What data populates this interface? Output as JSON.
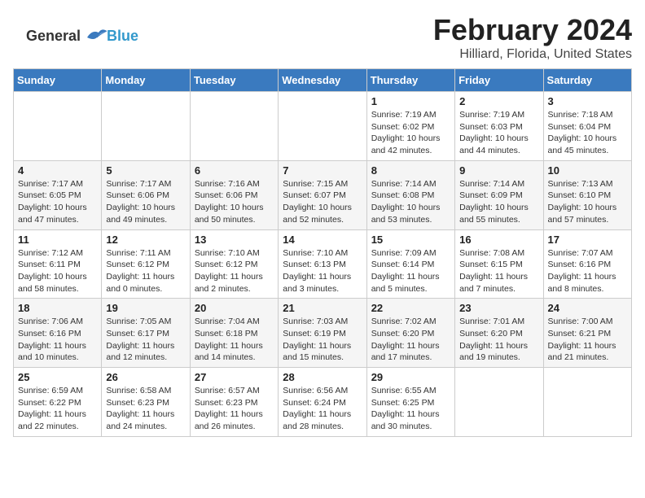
{
  "app": {
    "logo_general": "General",
    "logo_blue": "Blue"
  },
  "header": {
    "month_year": "February 2024",
    "location": "Hilliard, Florida, United States"
  },
  "weekdays": [
    "Sunday",
    "Monday",
    "Tuesday",
    "Wednesday",
    "Thursday",
    "Friday",
    "Saturday"
  ],
  "weeks": [
    [
      {
        "day": "",
        "info": ""
      },
      {
        "day": "",
        "info": ""
      },
      {
        "day": "",
        "info": ""
      },
      {
        "day": "",
        "info": ""
      },
      {
        "day": "1",
        "info": "Sunrise: 7:19 AM\nSunset: 6:02 PM\nDaylight: 10 hours\nand 42 minutes."
      },
      {
        "day": "2",
        "info": "Sunrise: 7:19 AM\nSunset: 6:03 PM\nDaylight: 10 hours\nand 44 minutes."
      },
      {
        "day": "3",
        "info": "Sunrise: 7:18 AM\nSunset: 6:04 PM\nDaylight: 10 hours\nand 45 minutes."
      }
    ],
    [
      {
        "day": "4",
        "info": "Sunrise: 7:17 AM\nSunset: 6:05 PM\nDaylight: 10 hours\nand 47 minutes."
      },
      {
        "day": "5",
        "info": "Sunrise: 7:17 AM\nSunset: 6:06 PM\nDaylight: 10 hours\nand 49 minutes."
      },
      {
        "day": "6",
        "info": "Sunrise: 7:16 AM\nSunset: 6:06 PM\nDaylight: 10 hours\nand 50 minutes."
      },
      {
        "day": "7",
        "info": "Sunrise: 7:15 AM\nSunset: 6:07 PM\nDaylight: 10 hours\nand 52 minutes."
      },
      {
        "day": "8",
        "info": "Sunrise: 7:14 AM\nSunset: 6:08 PM\nDaylight: 10 hours\nand 53 minutes."
      },
      {
        "day": "9",
        "info": "Sunrise: 7:14 AM\nSunset: 6:09 PM\nDaylight: 10 hours\nand 55 minutes."
      },
      {
        "day": "10",
        "info": "Sunrise: 7:13 AM\nSunset: 6:10 PM\nDaylight: 10 hours\nand 57 minutes."
      }
    ],
    [
      {
        "day": "11",
        "info": "Sunrise: 7:12 AM\nSunset: 6:11 PM\nDaylight: 10 hours\nand 58 minutes."
      },
      {
        "day": "12",
        "info": "Sunrise: 7:11 AM\nSunset: 6:12 PM\nDaylight: 11 hours\nand 0 minutes."
      },
      {
        "day": "13",
        "info": "Sunrise: 7:10 AM\nSunset: 6:12 PM\nDaylight: 11 hours\nand 2 minutes."
      },
      {
        "day": "14",
        "info": "Sunrise: 7:10 AM\nSunset: 6:13 PM\nDaylight: 11 hours\nand 3 minutes."
      },
      {
        "day": "15",
        "info": "Sunrise: 7:09 AM\nSunset: 6:14 PM\nDaylight: 11 hours\nand 5 minutes."
      },
      {
        "day": "16",
        "info": "Sunrise: 7:08 AM\nSunset: 6:15 PM\nDaylight: 11 hours\nand 7 minutes."
      },
      {
        "day": "17",
        "info": "Sunrise: 7:07 AM\nSunset: 6:16 PM\nDaylight: 11 hours\nand 8 minutes."
      }
    ],
    [
      {
        "day": "18",
        "info": "Sunrise: 7:06 AM\nSunset: 6:16 PM\nDaylight: 11 hours\nand 10 minutes."
      },
      {
        "day": "19",
        "info": "Sunrise: 7:05 AM\nSunset: 6:17 PM\nDaylight: 11 hours\nand 12 minutes."
      },
      {
        "day": "20",
        "info": "Sunrise: 7:04 AM\nSunset: 6:18 PM\nDaylight: 11 hours\nand 14 minutes."
      },
      {
        "day": "21",
        "info": "Sunrise: 7:03 AM\nSunset: 6:19 PM\nDaylight: 11 hours\nand 15 minutes."
      },
      {
        "day": "22",
        "info": "Sunrise: 7:02 AM\nSunset: 6:20 PM\nDaylight: 11 hours\nand 17 minutes."
      },
      {
        "day": "23",
        "info": "Sunrise: 7:01 AM\nSunset: 6:20 PM\nDaylight: 11 hours\nand 19 minutes."
      },
      {
        "day": "24",
        "info": "Sunrise: 7:00 AM\nSunset: 6:21 PM\nDaylight: 11 hours\nand 21 minutes."
      }
    ],
    [
      {
        "day": "25",
        "info": "Sunrise: 6:59 AM\nSunset: 6:22 PM\nDaylight: 11 hours\nand 22 minutes."
      },
      {
        "day": "26",
        "info": "Sunrise: 6:58 AM\nSunset: 6:23 PM\nDaylight: 11 hours\nand 24 minutes."
      },
      {
        "day": "27",
        "info": "Sunrise: 6:57 AM\nSunset: 6:23 PM\nDaylight: 11 hours\nand 26 minutes."
      },
      {
        "day": "28",
        "info": "Sunrise: 6:56 AM\nSunset: 6:24 PM\nDaylight: 11 hours\nand 28 minutes."
      },
      {
        "day": "29",
        "info": "Sunrise: 6:55 AM\nSunset: 6:25 PM\nDaylight: 11 hours\nand 30 minutes."
      },
      {
        "day": "",
        "info": ""
      },
      {
        "day": "",
        "info": ""
      }
    ]
  ]
}
